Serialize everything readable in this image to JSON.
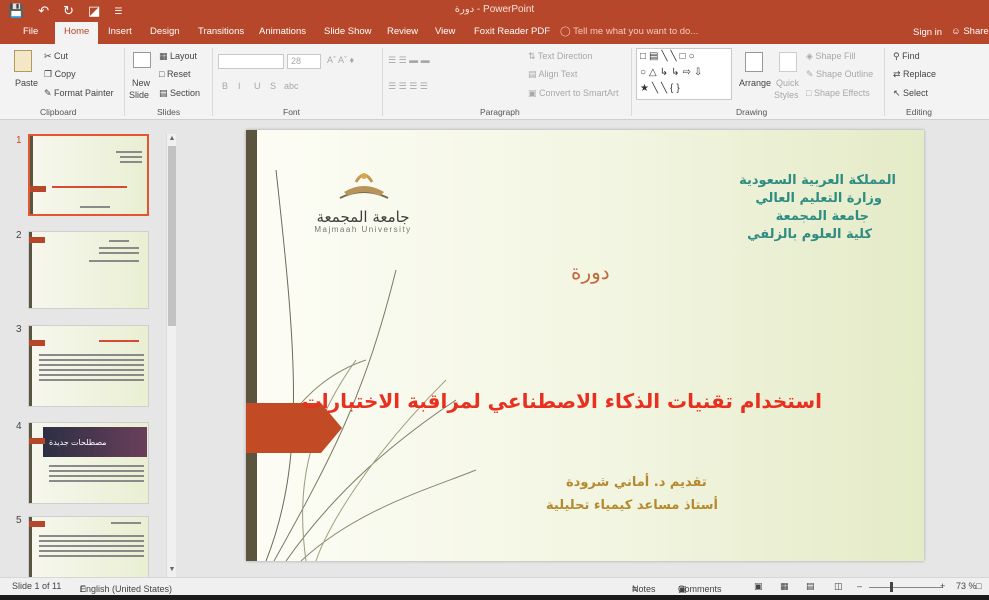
{
  "window": {
    "title": "دورة - PowerPoint"
  },
  "qat": {
    "save_icon": "save-icon",
    "undo_icon": "undo-icon",
    "redo_icon": "redo-icon",
    "customize_icon": "customize-icon"
  },
  "tabs": [
    {
      "label": "File"
    },
    {
      "label": "Home"
    },
    {
      "label": "Insert"
    },
    {
      "label": "Design"
    },
    {
      "label": "Transitions"
    },
    {
      "label": "Animations"
    },
    {
      "label": "Slide Show"
    },
    {
      "label": "Review"
    },
    {
      "label": "View"
    },
    {
      "label": "Foxit Reader PDF"
    }
  ],
  "tellme": "Tell me what you want to do...",
  "account": {
    "signin": "Sign in",
    "share": "Share"
  },
  "ribbon": {
    "clipboard": {
      "paste": "Paste",
      "cut": "Cut",
      "copy": "Copy",
      "format_painter": "Format Painter",
      "label": "Clipboard"
    },
    "slides": {
      "new_slide": "New",
      "new_slide2": "Slide",
      "layout": "Layout",
      "reset": "Reset",
      "section": "Section",
      "label": "Slides"
    },
    "font": {
      "size": "28",
      "label": "Font",
      "bold": "B",
      "italic": "I",
      "underline": "U",
      "strike": "S",
      "shadow": "abc"
    },
    "paragraph": {
      "text_direction": "Text Direction",
      "align_text": "Align Text",
      "smartart": "Convert to SmartArt",
      "label": "Paragraph"
    },
    "drawing": {
      "arrange": "Arrange",
      "quick_styles": "Quick",
      "quick_styles2": "Styles",
      "shape_fill": "Shape Fill",
      "shape_outline": "Shape Outline",
      "shape_effects": "Shape Effects",
      "label": "Drawing"
    },
    "editing": {
      "find": "Find",
      "replace": "Replace",
      "select": "Select",
      "label": "Editing"
    }
  },
  "thumbnails": [
    {
      "number": "1"
    },
    {
      "number": "2"
    },
    {
      "number": "3"
    },
    {
      "number": "4",
      "caption": "مصطلحات جديدة"
    },
    {
      "number": "5"
    }
  ],
  "slide": {
    "header_lines": [
      "المملكة العربية السعودية",
      "وزارة التعليم العالي",
      "جامعة المجمعة",
      "كلية العلوم بالزلفي"
    ],
    "course": "دورة",
    "main_title": "استخدام تقنيات الذكاء الاصطناعي لمراقبة الاختبارات",
    "presenter": "تقديم د. أماني شرودة",
    "position": "أستاذ مساعد كيمياء تحليلية",
    "logo_ar": "جامعة المجمعة",
    "logo_en": "Majmaah University"
  },
  "status": {
    "slide_info": "Slide 1 of 11",
    "language": "English (United States)",
    "notes": "Notes",
    "comments": "Comments",
    "zoom": "73 %"
  },
  "colors": {
    "accent": "#b7472a",
    "title_red": "#e83020",
    "header_teal": "#2e8c82",
    "sub_gold": "#b58a2f"
  }
}
